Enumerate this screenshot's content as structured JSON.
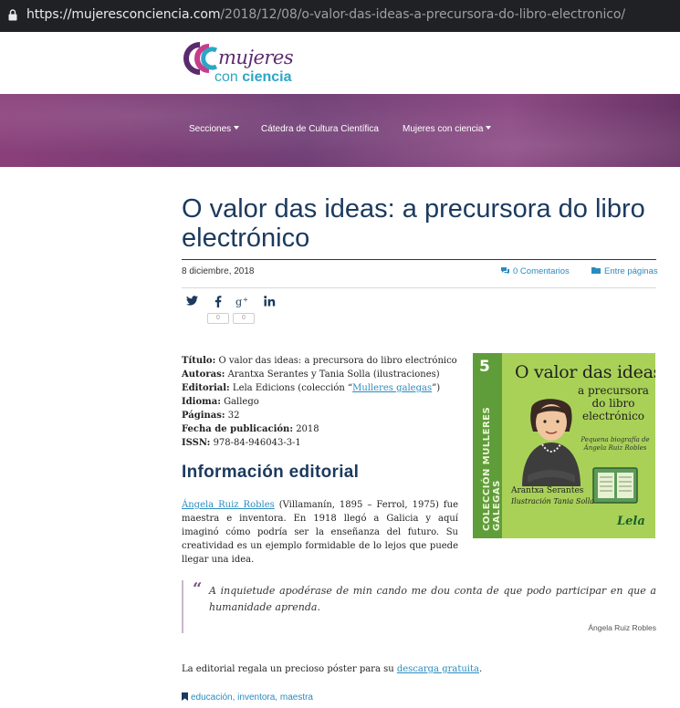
{
  "browser": {
    "url_host": "https://mujeresconciencia.com",
    "url_path": "/2018/12/08/o-valor-das-ideas-a-precursora-do-libro-electronico/"
  },
  "site": {
    "logo_word1": "mujeres",
    "logo_word2a": "con ",
    "logo_word2b": "ciencia"
  },
  "nav": {
    "items": [
      {
        "label": "Secciones",
        "dropdown": true
      },
      {
        "label": "Cátedra de Cultura Científica",
        "dropdown": false
      },
      {
        "label": "Mujeres con ciencia",
        "dropdown": true
      }
    ]
  },
  "article": {
    "title": "O valor das ideas: a precursora do libro electrónico",
    "date": "8 diciembre, 2018",
    "comments": "0 Comentarios",
    "category": "Entre páginas",
    "share": {
      "facebook_count": "0",
      "gplus_count": "0"
    },
    "meta": [
      {
        "label": "Título:",
        "value": " O valor das ideas: a precursora do libro electrónico"
      },
      {
        "label": "Autoras:",
        "value": " Arantxa Serantes y Tania Solla (ilustraciones)"
      },
      {
        "label": "Editorial:",
        "value": " Lela Edicions (colección “",
        "link": "Mulleres galegas",
        "after": "”)"
      },
      {
        "label": "Idioma:",
        "value": " Gallego"
      },
      {
        "label": "Páginas:",
        "value": " 32"
      },
      {
        "label": "Fecha de publicación:",
        "value": " 2018"
      },
      {
        "label": "ISSN:",
        "value": " 978-84-946043-3-1"
      }
    ],
    "section_heading": "Información editorial",
    "para_link": "Ángela Ruiz Robles",
    "para_text": " (Villamanín, 1895 – Ferrol, 1975) fue maestra e inventora. En 1918 llegó a Galicia y aquí imaginó cómo podría ser la enseñanza del futuro. Su creatividad es un ejemplo formidable de lo lejos que puede llegar una idea.",
    "quote": "A inquietude apodérase de min cando me dou conta de que podo participar  en que a humanidade aprenda.",
    "quote_author": "Ángela Ruiz Robles",
    "para2_before": "La editorial regala un precioso póster para su ",
    "para2_link": "descarga gratuita",
    "para2_after": ".",
    "tags": [
      "educación",
      "inventora",
      "maestra"
    ]
  },
  "cover": {
    "number": "5",
    "series": "MULLERES GALEGAS",
    "collection": "COLECCIÓN",
    "title_line1": "O valor das ideas:",
    "title_rest": "a precursora do libro electrónico",
    "subtitle": "Pequena biografía de Ángela Ruiz Robles",
    "author": "Arantxa Serantes",
    "illustrator": "Ilustración Tania Solla",
    "publisher": "Lela",
    "colors": {
      "background": "#a9d158",
      "band": "#5f9d3a"
    }
  },
  "colors": {
    "title": "#1b3a5e",
    "link": "#2b8bbf",
    "nav_band": "#7a3d78"
  }
}
